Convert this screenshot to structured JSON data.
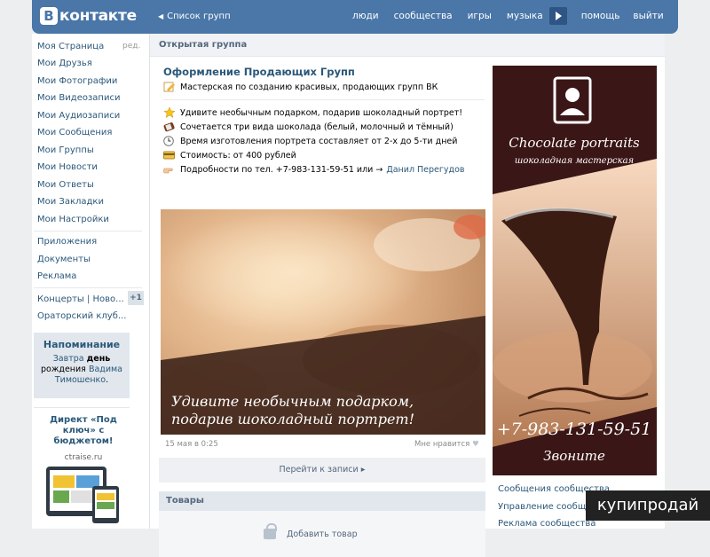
{
  "header": {
    "logo_letter": "В",
    "logo_text": "контакте",
    "breadcrumb": "Список групп",
    "nav": [
      "люди",
      "сообщества",
      "игры",
      "музыка",
      "помощь",
      "выйти"
    ]
  },
  "sidebar": {
    "edit_label": "ред.",
    "items": [
      "Моя Страница",
      "Мои Друзья",
      "Мои Фотографии",
      "Мои Видеозаписи",
      "Мои Аудиозаписи",
      "Мои Сообщения",
      "Мои Группы",
      "Мои Новости",
      "Мои Ответы",
      "Мои Закладки",
      "Мои Настройки"
    ],
    "extra": [
      "Приложения",
      "Документы",
      "Реклама"
    ],
    "groups": [
      "Концерты | Ново...",
      "Ораторский клуб..."
    ],
    "groups_badge": "+1",
    "reminder": {
      "title": "Напоминание",
      "text_before": "Завтра",
      "text_bold": "день",
      "text_mid": "рождения",
      "name": "Вадима Тимошенко",
      "tail": "."
    },
    "ad": {
      "title": "Директ «Под ключ» с бюджетом!",
      "url": "ctraise.ru"
    }
  },
  "main": {
    "header": "Открытая группа",
    "post": {
      "group_name": "Оформление Продающих Групп",
      "subtitle": "Мастерская по созданию красивых, продающих групп ВК",
      "lines": [
        "Удивите необычным подарком, подарив шоколадный портрет!",
        "Сочетается три вида шоколада (белый, молочный и тёмный)",
        "Время изготовления портрета составляет от 2-х до 5-ти дней",
        "Стоимость: от 400 рублей",
        "Подробности по тел. +7-983-131-59-51 или →"
      ],
      "contact_name": "Данил Перегудов",
      "photo_caption_1": "Удивите необычным подарком,",
      "photo_caption_2": "подарив шоколадный портрет!",
      "date": "15 мая в 0:25",
      "like": "Мне нравится",
      "goto": "Перейти к записи"
    },
    "goods": {
      "title": "Товары",
      "add": "Добавить товар"
    },
    "banner": {
      "title": "Chocolate portraits",
      "subtitle": "шоколадная мастерская",
      "phone": "+7-983-131-59-51",
      "cta": "Звоните"
    },
    "right_links": [
      "Сообщения сообщества",
      "Управление сообществом",
      "Реклама сообщества"
    ]
  },
  "watermark": "купипродай",
  "colors": {
    "accent": "#4a76a8",
    "link": "#2b587a",
    "banner_dark": "#3b1616"
  }
}
